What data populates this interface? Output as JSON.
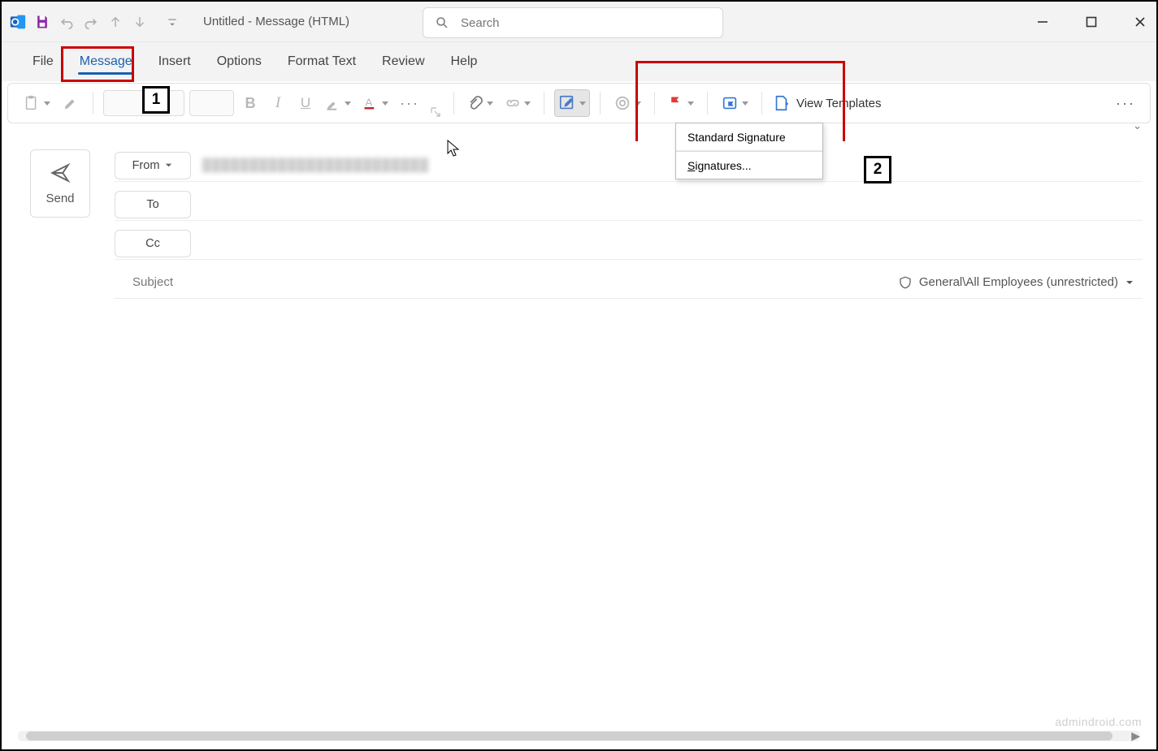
{
  "titlebar": {
    "title": "Untitled  -  Message (HTML)",
    "search_placeholder": "Search"
  },
  "menu": {
    "tabs": [
      "File",
      "Message",
      "Insert",
      "Options",
      "Format Text",
      "Review",
      "Help"
    ],
    "active_index": 1
  },
  "ribbon": {
    "view_templates": "View Templates"
  },
  "callouts": {
    "num1": "1",
    "num2": "2"
  },
  "signature_menu": {
    "item1": "Standard Signature",
    "item2_prefix": "S",
    "item2_rest": "ignatures..."
  },
  "compose": {
    "send": "Send",
    "from": "From",
    "to": "To",
    "cc": "Cc",
    "subject": "Subject",
    "from_addr_blur": "████████████████████████",
    "sensitivity": "General\\All Employees (unrestricted)"
  },
  "watermark": "admindroid.com"
}
